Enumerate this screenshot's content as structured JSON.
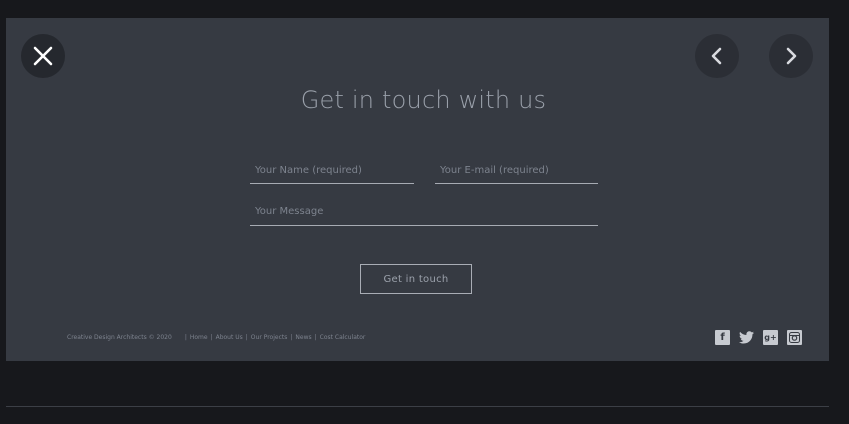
{
  "form": {
    "title": "Get in touch with us",
    "name_placeholder": "Your Name (required)",
    "email_placeholder": "Your E-mail (required)",
    "message_placeholder": "Your Message",
    "submit_label": "Get in touch"
  },
  "footer": {
    "copyright": "Creative Design Architects © 2020",
    "links": [
      "Home",
      "About Us",
      "Our Projects",
      "News",
      "Cost Calculator"
    ]
  },
  "social": {
    "facebook": "f",
    "googleplus": "g+",
    "twitter": "🐦"
  },
  "icons": {
    "close": "close-icon",
    "prev": "chevron-left-icon",
    "next": "chevron-right-icon"
  },
  "colors": {
    "background": "#17181c",
    "panel": "#363a42",
    "text_muted": "#7d838e",
    "heading": "#9aa0aa"
  }
}
